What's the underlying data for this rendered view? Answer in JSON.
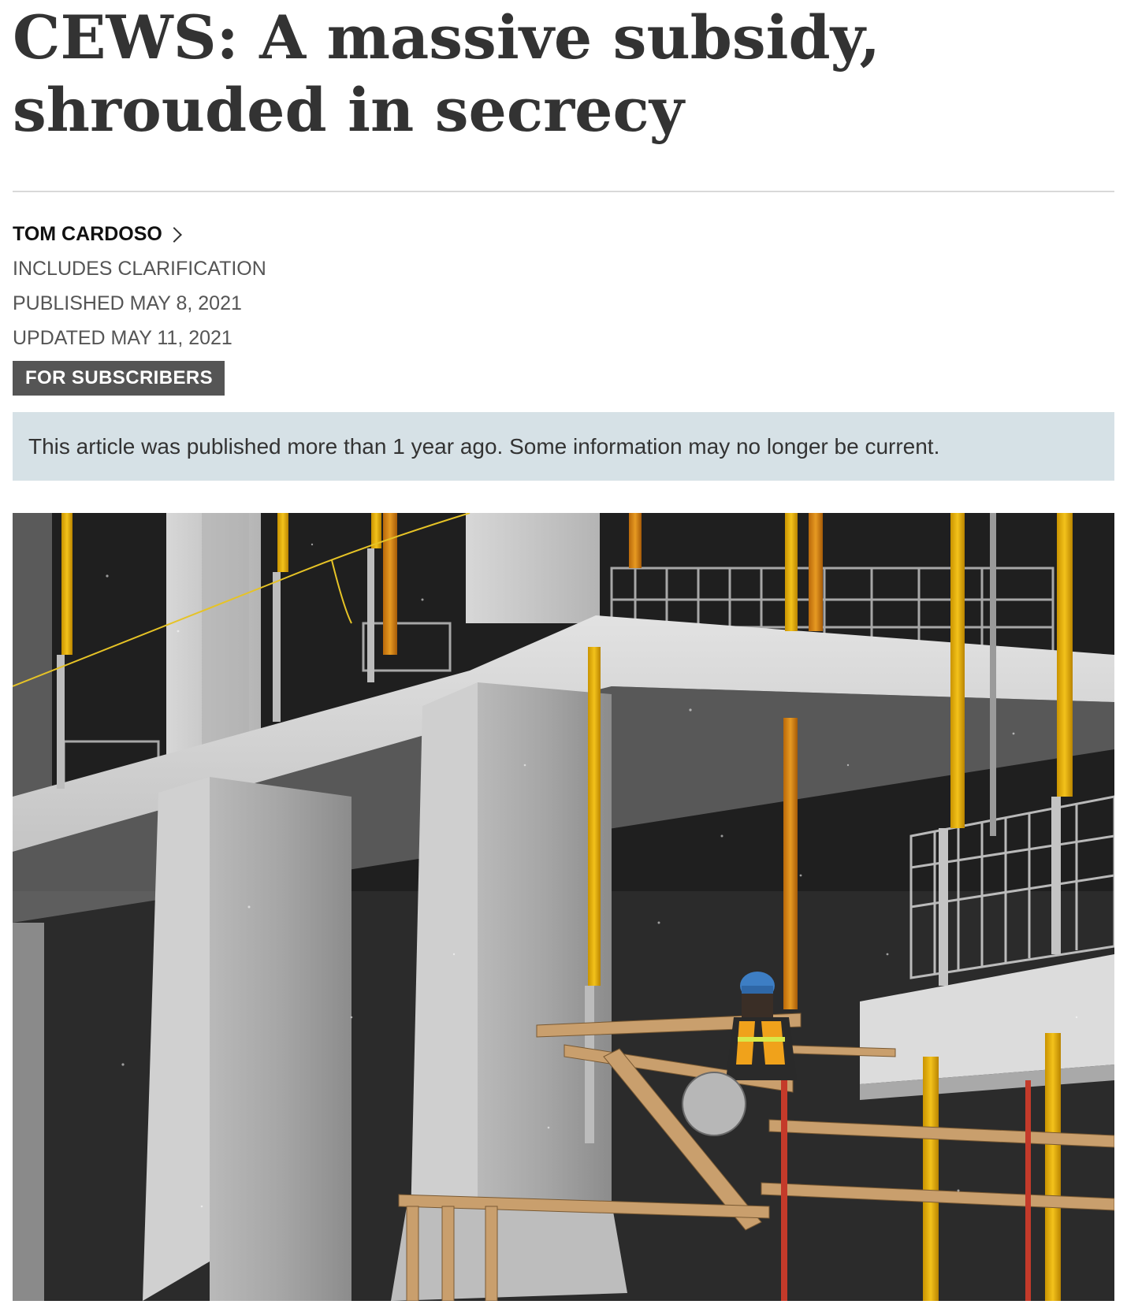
{
  "article": {
    "headline": "CEWS: A massive subsidy, shrouded in secrecy",
    "author": "TOM CARDOSO",
    "clarification": "INCLUDES CLARIFICATION",
    "published": "PUBLISHED MAY 8, 2021",
    "updated": "UPDATED MAY 11, 2021",
    "badge": "FOR SUBSCRIBERS",
    "notice": "This article was published more than 1 year ago. Some information may no longer be current."
  },
  "icons": {
    "author_link": "chevron-right-icon"
  },
  "colors": {
    "headline": "#333333",
    "badge_bg": "#555555",
    "notice_bg": "#d6e1e6",
    "divider": "#d9d9d9"
  }
}
